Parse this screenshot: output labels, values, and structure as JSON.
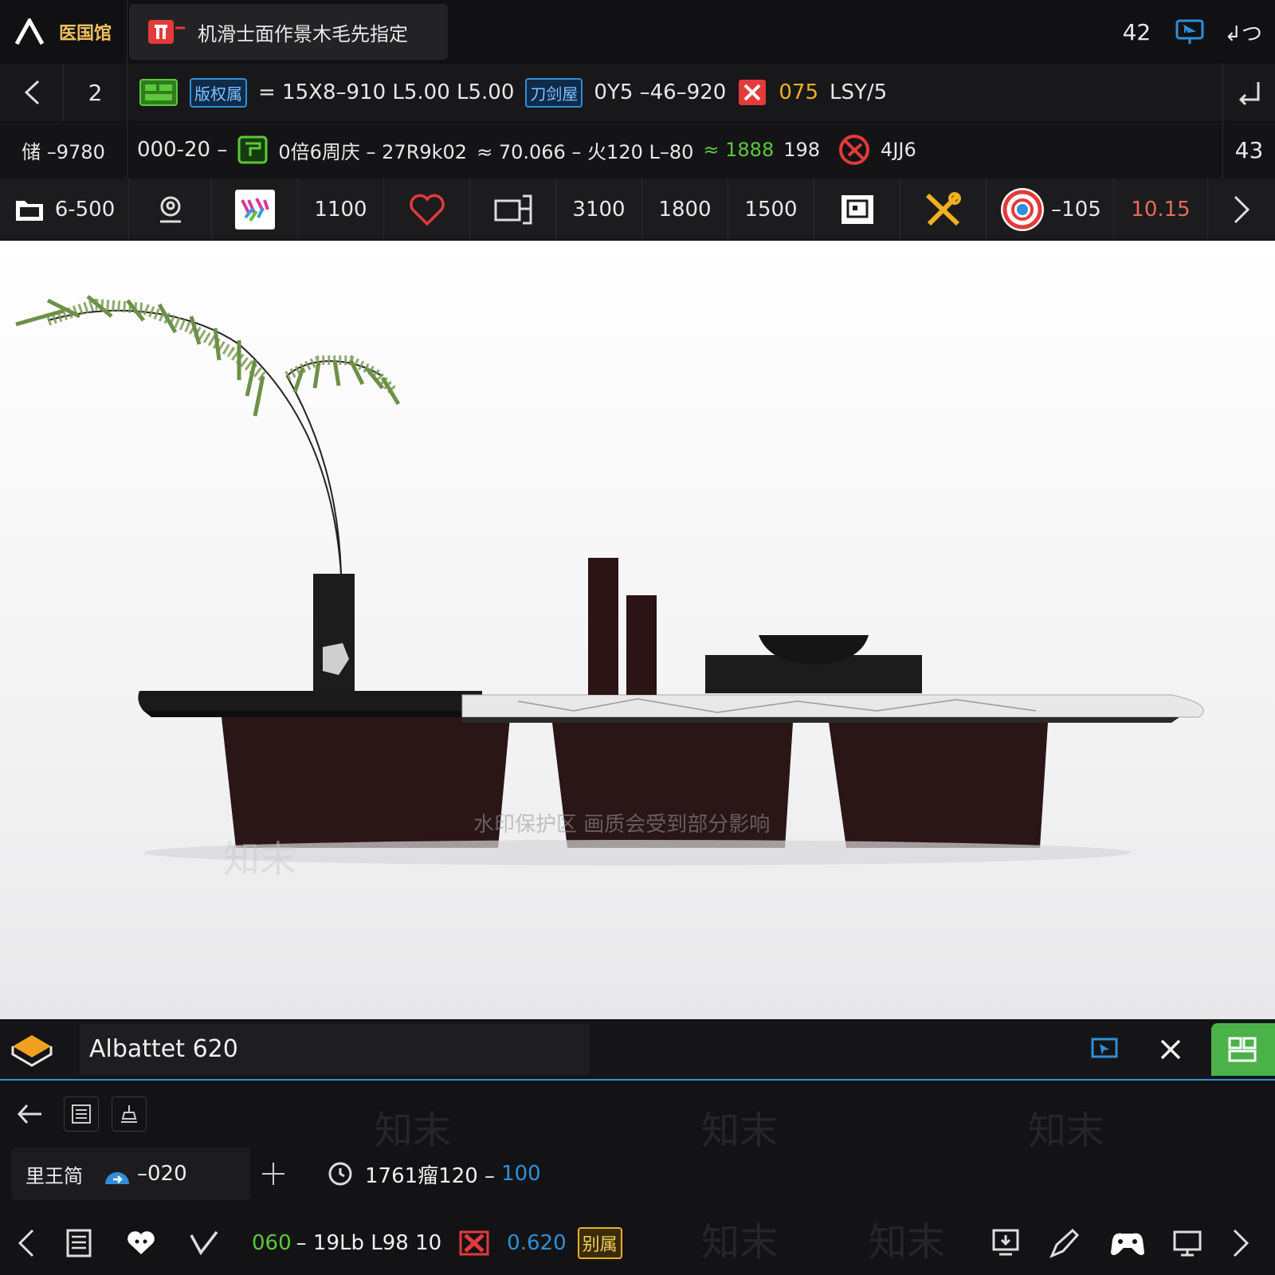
{
  "header": {
    "logo_text": "医国馆",
    "tab_title": "机滑士面作景木毛先指定",
    "count": "42",
    "right_label": "↲つ"
  },
  "row2": {
    "page_num": "2",
    "badge_blue_1": "版权属",
    "text_1": "= 15X8–910  L5.00  L5.00",
    "badge_blue_2": "刀剑屋",
    "text_2": "0Y5 –46–920",
    "text_orange": "075",
    "text_3": "LSY/5"
  },
  "row3": {
    "left_text": "储 –9780",
    "code_1": "000-20 –",
    "text_1": "0倍6周庆 – 27R9k02",
    "text_2": "≈ 70.066 – 火120 L–80",
    "text_green": "≈ 1888",
    "text_3": "198",
    "text_4": "4JJ6",
    "count": "43"
  },
  "toolbar": {
    "folder_text": "6-500",
    "v1": "1100",
    "v2": "3100",
    "v3": "1800",
    "v4": "1500",
    "target_text": "–105",
    "red_value": "10.15"
  },
  "panel": {
    "title": "Albattet 620",
    "tool_label": "里王简",
    "value_1": "–020",
    "coord_text": "1761瘤120 –",
    "coord_blue": "100",
    "status_green": "060",
    "status_text": "– 19Lb  L98 10",
    "status_blue": "0.620",
    "status_badge": "别属"
  },
  "watermark": {
    "main": "水印保护区  画质会受到部分影响",
    "brand": "知末"
  },
  "colors": {
    "accent_blue": "#2f8fd8",
    "accent_green": "#5cc83a",
    "accent_red": "#e33a3a",
    "accent_orange": "#f2b01e"
  }
}
